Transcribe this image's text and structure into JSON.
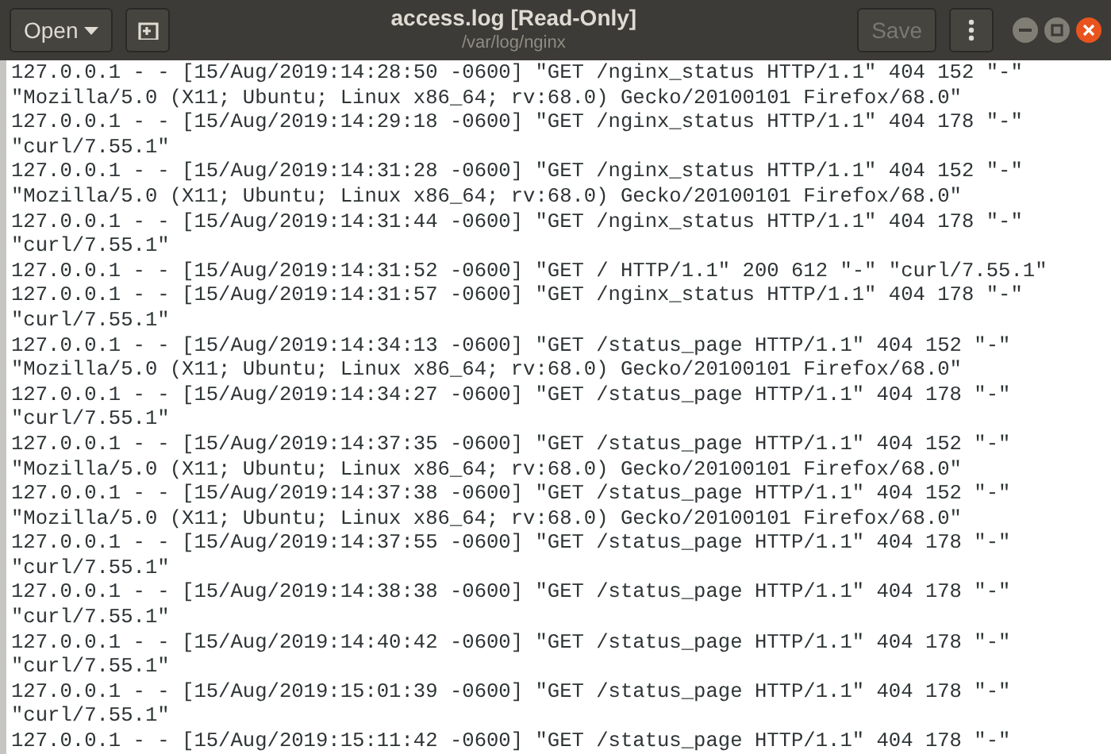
{
  "window": {
    "title": "access.log [Read-Only]",
    "subtitle": "/var/log/nginx"
  },
  "toolbar": {
    "open_label": "Open",
    "save_label": "Save",
    "save_disabled": true
  },
  "lines": [
    "127.0.0.1 - - [15/Aug/2019:14:28:50 -0600] \"GET /nginx_status HTTP/1.1\" 404 152 \"-\"",
    "\"Mozilla/5.0 (X11; Ubuntu; Linux x86_64; rv:68.0) Gecko/20100101 Firefox/68.0\"",
    "127.0.0.1 - - [15/Aug/2019:14:29:18 -0600] \"GET /nginx_status HTTP/1.1\" 404 178 \"-\"",
    "\"curl/7.55.1\"",
    "127.0.0.1 - - [15/Aug/2019:14:31:28 -0600] \"GET /nginx_status HTTP/1.1\" 404 152 \"-\"",
    "\"Mozilla/5.0 (X11; Ubuntu; Linux x86_64; rv:68.0) Gecko/20100101 Firefox/68.0\"",
    "127.0.0.1 - - [15/Aug/2019:14:31:44 -0600] \"GET /nginx_status HTTP/1.1\" 404 178 \"-\"",
    "\"curl/7.55.1\"",
    "127.0.0.1 - - [15/Aug/2019:14:31:52 -0600] \"GET / HTTP/1.1\" 200 612 \"-\" \"curl/7.55.1\"",
    "127.0.0.1 - - [15/Aug/2019:14:31:57 -0600] \"GET /nginx_status HTTP/1.1\" 404 178 \"-\"",
    "\"curl/7.55.1\"",
    "127.0.0.1 - - [15/Aug/2019:14:34:13 -0600] \"GET /status_page HTTP/1.1\" 404 152 \"-\"",
    "\"Mozilla/5.0 (X11; Ubuntu; Linux x86_64; rv:68.0) Gecko/20100101 Firefox/68.0\"",
    "127.0.0.1 - - [15/Aug/2019:14:34:27 -0600] \"GET /status_page HTTP/1.1\" 404 178 \"-\"",
    "\"curl/7.55.1\"",
    "127.0.0.1 - - [15/Aug/2019:14:37:35 -0600] \"GET /status_page HTTP/1.1\" 404 152 \"-\"",
    "\"Mozilla/5.0 (X11; Ubuntu; Linux x86_64; rv:68.0) Gecko/20100101 Firefox/68.0\"",
    "127.0.0.1 - - [15/Aug/2019:14:37:38 -0600] \"GET /status_page HTTP/1.1\" 404 152 \"-\"",
    "\"Mozilla/5.0 (X11; Ubuntu; Linux x86_64; rv:68.0) Gecko/20100101 Firefox/68.0\"",
    "127.0.0.1 - - [15/Aug/2019:14:37:55 -0600] \"GET /status_page HTTP/1.1\" 404 178 \"-\"",
    "\"curl/7.55.1\"",
    "127.0.0.1 - - [15/Aug/2019:14:38:38 -0600] \"GET /status_page HTTP/1.1\" 404 178 \"-\"",
    "\"curl/7.55.1\"",
    "127.0.0.1 - - [15/Aug/2019:14:40:42 -0600] \"GET /status_page HTTP/1.1\" 404 178 \"-\"",
    "\"curl/7.55.1\"",
    "127.0.0.1 - - [15/Aug/2019:15:01:39 -0600] \"GET /status_page HTTP/1.1\" 404 178 \"-\"",
    "\"curl/7.55.1\"",
    "127.0.0.1 - - [15/Aug/2019:15:11:42 -0600] \"GET /status_page HTTP/1.1\" 404 178 \"-\""
  ]
}
